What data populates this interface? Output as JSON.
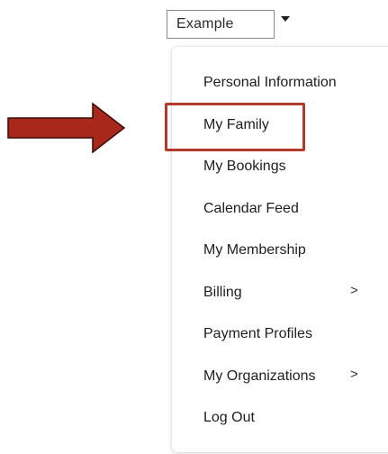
{
  "account": {
    "name": "Example"
  },
  "menu": {
    "items": [
      {
        "label": "Personal Information",
        "has_submenu": false
      },
      {
        "label": "My Family",
        "has_submenu": false,
        "highlighted": true
      },
      {
        "label": "My Bookings",
        "has_submenu": false
      },
      {
        "label": "Calendar Feed",
        "has_submenu": false
      },
      {
        "label": "My Membership",
        "has_submenu": false
      },
      {
        "label": "Billing",
        "has_submenu": true
      },
      {
        "label": "Payment Profiles",
        "has_submenu": false
      },
      {
        "label": "My Organizations",
        "has_submenu": true
      },
      {
        "label": "Log Out",
        "has_submenu": false
      }
    ],
    "submenu_glyph": ">"
  },
  "icons": {
    "caret": "caret-down-icon",
    "submenu": "chevron-right-icon",
    "pointer": "arrow-right-icon"
  },
  "colors": {
    "highlight": "#b23a2a",
    "arrow_fill": "#a8281b",
    "arrow_stroke": "#3a0a05"
  }
}
